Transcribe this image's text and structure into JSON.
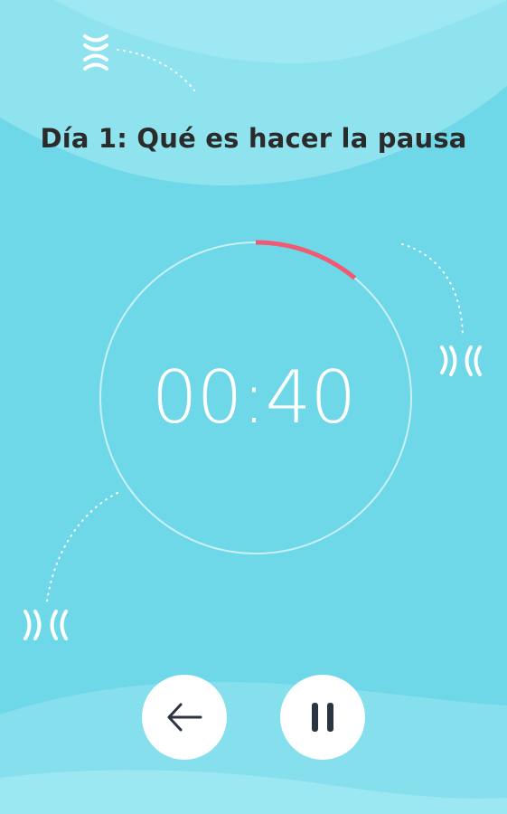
{
  "screen": {
    "title": "Día 1: Qué es hacer la pausa",
    "timer": "00:40",
    "progress_fraction": 0.11
  },
  "controls": {
    "back_icon": "arrow-left-icon",
    "pause_icon": "pause-icon"
  },
  "colors": {
    "background": "#6ed8e8",
    "wave_light": "#8fe3ef",
    "progress": "#f05a72",
    "ring": "#d9f5f9",
    "icon_dark": "#2b3440"
  }
}
